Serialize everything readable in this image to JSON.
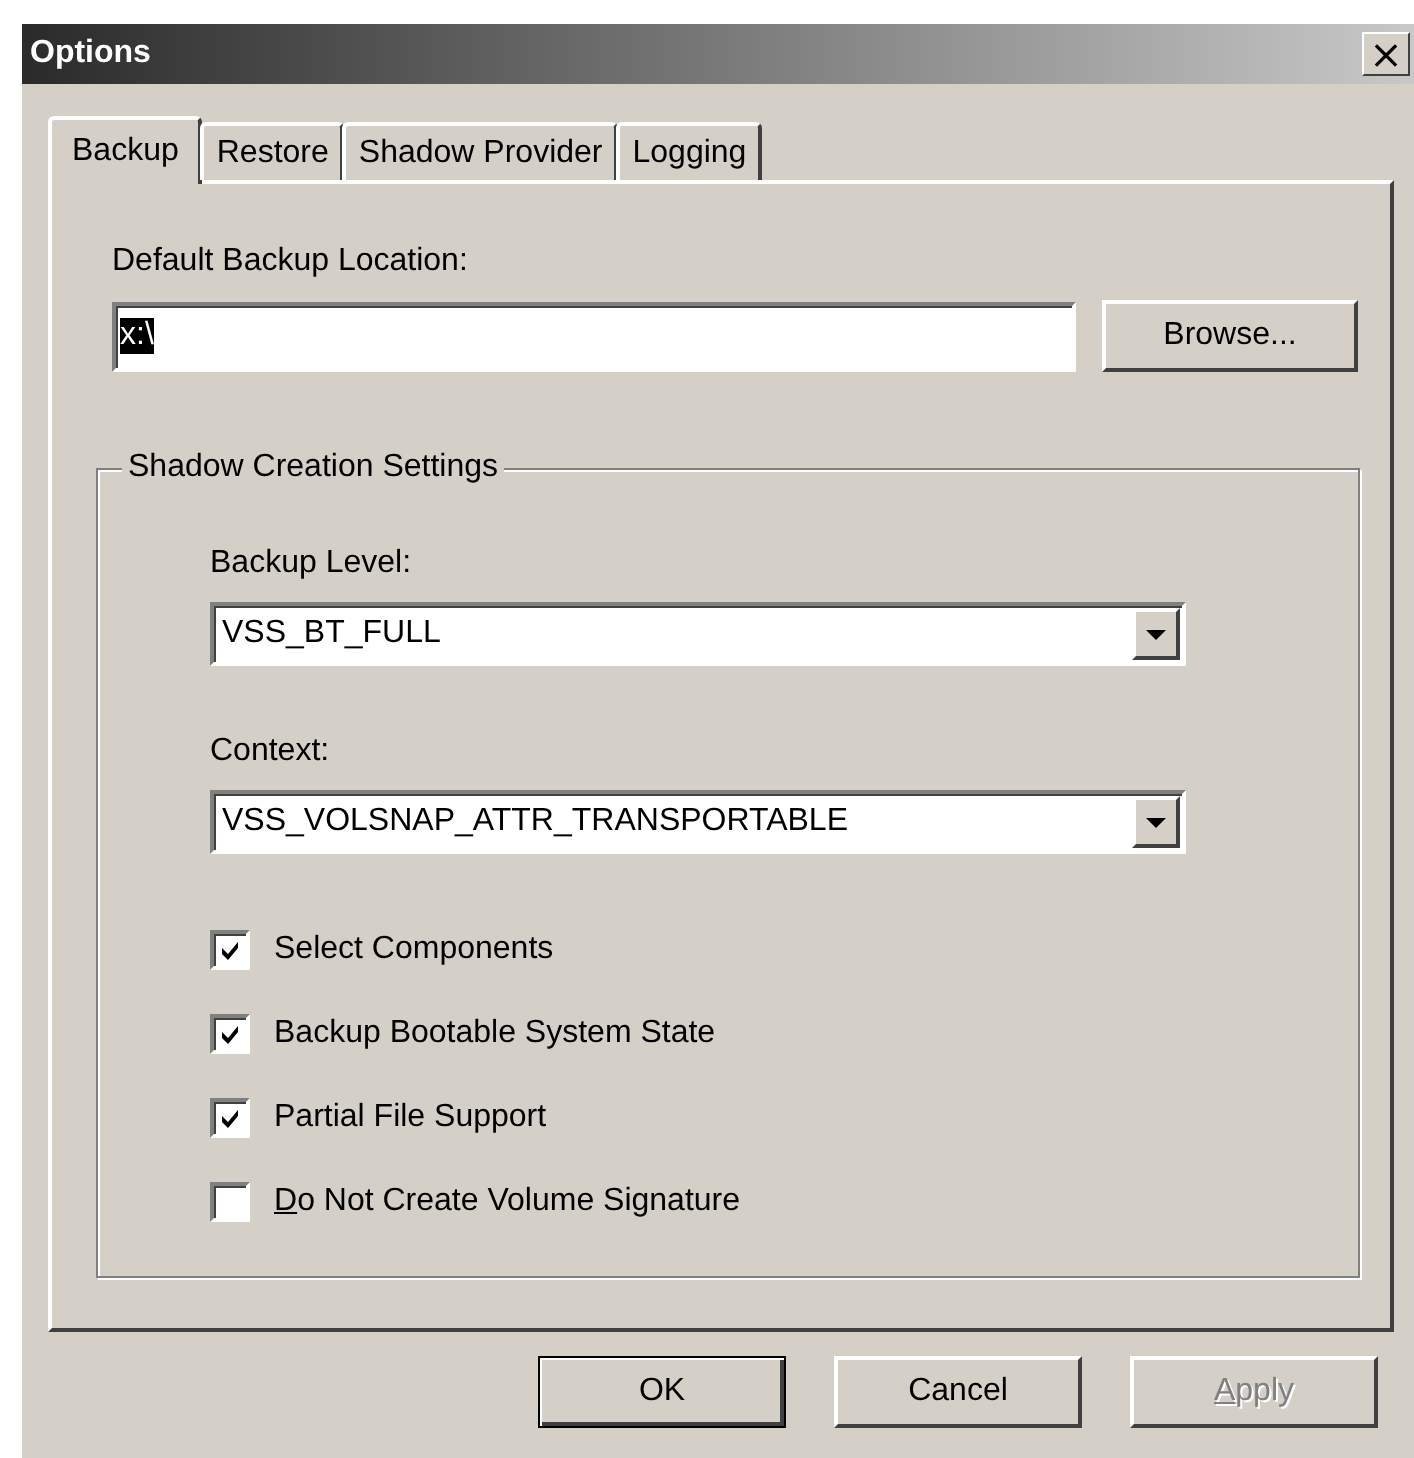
{
  "window": {
    "title": "Options",
    "close": "×"
  },
  "tabs": [
    {
      "label": "Backup",
      "selected": true
    },
    {
      "label": "Restore",
      "selected": false
    },
    {
      "label": "Shadow Provider",
      "selected": false
    },
    {
      "label": "Logging",
      "selected": false
    }
  ],
  "backup_location": {
    "label": "Default Backup Location:",
    "value": "x:\\",
    "browse": "Browse..."
  },
  "shadow_group": {
    "title": "Shadow Creation Settings",
    "backup_level": {
      "label": "Backup Level:",
      "value": "VSS_BT_FULL"
    },
    "context": {
      "label": "Context:",
      "value": "VSS_VOLSNAP_ATTR_TRANSPORTABLE"
    },
    "options": [
      {
        "label": "Select Components",
        "checked": true,
        "underline_first": false
      },
      {
        "label": "Backup Bootable System State",
        "checked": true,
        "underline_first": false
      },
      {
        "label": "Partial File Support",
        "checked": true,
        "underline_first": false
      },
      {
        "label": "Do Not Create Volume Signature",
        "checked": false,
        "underline_first": true
      }
    ]
  },
  "buttons": [
    {
      "label": "OK",
      "default": true,
      "disabled": false,
      "underline_first": false
    },
    {
      "label": "Cancel",
      "default": false,
      "disabled": false,
      "underline_first": false
    },
    {
      "label": "Apply",
      "default": false,
      "disabled": true,
      "underline_first": true
    }
  ]
}
